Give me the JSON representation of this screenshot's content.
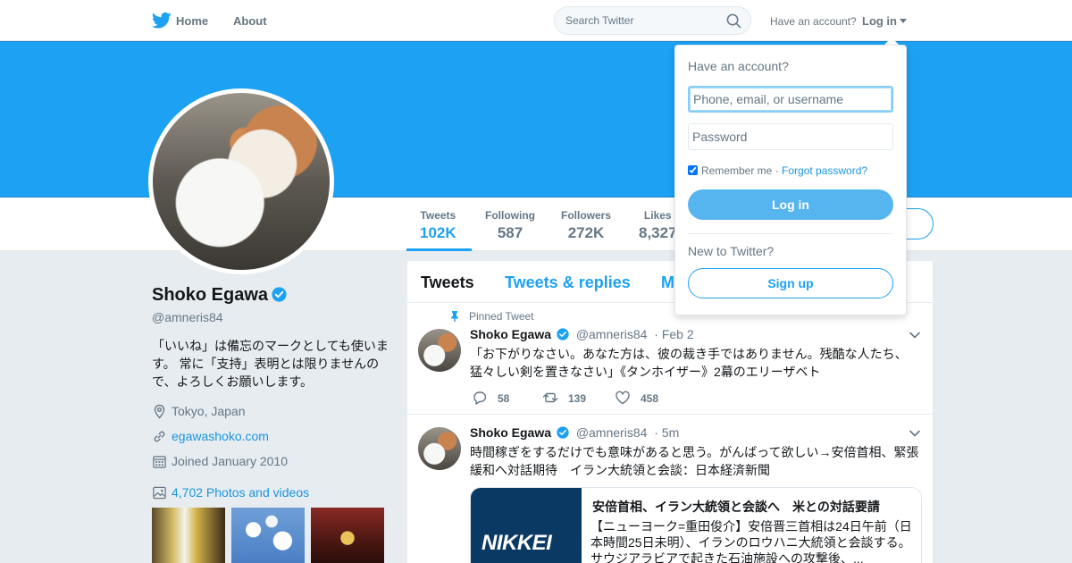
{
  "nav": {
    "home_label": "Home",
    "about_label": "About",
    "search_placeholder": "Search Twitter",
    "have_account_text": "Have an account?",
    "login_label": "Log in"
  },
  "profile": {
    "name": "Shoko Egawa",
    "handle": "@amneris84",
    "bio": "「いいね」は備忘のマークとしても使います。 常に「支持」表明とは限りませんので、よろしくお願いします。",
    "location": "Tokyo, Japan",
    "website": "egawashoko.com",
    "joined": "Joined January 2010",
    "photos_label": "4,702 Photos and videos"
  },
  "stats": [
    {
      "label": "Tweets",
      "value": "102K"
    },
    {
      "label": "Following",
      "value": "587"
    },
    {
      "label": "Followers",
      "value": "272K"
    },
    {
      "label": "Likes",
      "value": "8,327"
    }
  ],
  "timeline": {
    "tabs": [
      "Tweets",
      "Tweets & replies",
      "M"
    ],
    "tweets": [
      {
        "pinned_label": "Pinned Tweet",
        "name": "Shoko Egawa",
        "handle": "@amneris84",
        "time": "· Feb 2",
        "text": "「お下がりなさい。あなた方は、彼の裁き手ではありません。残酷な人たち、猛々しい剣を置きなさい」《タンホイザー》2幕のエリーザベト",
        "replies": "58",
        "retweets": "139",
        "likes": "458"
      },
      {
        "name": "Shoko Egawa",
        "handle": "@amneris84",
        "time": "· 5m",
        "text": "時間稼ぎをするだけでも意味があると思う。がんばって欲しい→安倍首相、緊張緩和へ対話期待　イラン大統領と会談：日本経済新聞",
        "card": {
          "image_text": "NIKKEI",
          "title": "安倍首相、イラン大統領と会談へ　米との対話要請",
          "description": "【ニューヨーク=重田俊介】安倍晋三首相は24日午前（日本時間25日未明）、イランのロウハニ大統領と会談する。サウジアラビアで起きた石油施設への攻撃後、..."
        }
      }
    ]
  },
  "login_dropdown": {
    "title": "Have an account?",
    "username_placeholder": "Phone, email, or username",
    "password_placeholder": "Password",
    "remember_label": "Remember me",
    "separator": " · ",
    "forgot_label": "Forgot password?",
    "login_button": "Log in",
    "new_label": "New to Twitter?",
    "signup_button": "Sign up"
  },
  "colors": {
    "brand": "#1da1f2",
    "banner": "#1da1f2",
    "link": "#1b95e0",
    "background": "#e6ecf0"
  }
}
